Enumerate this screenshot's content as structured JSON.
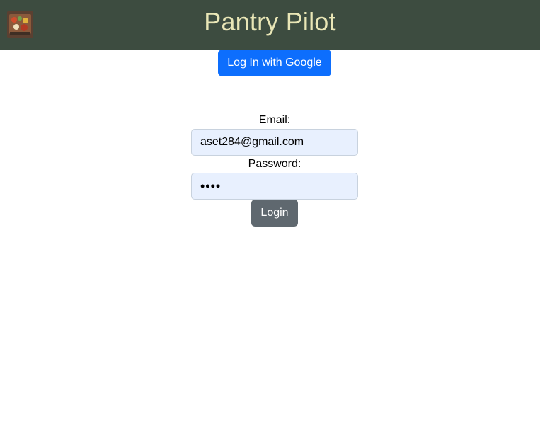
{
  "header": {
    "title": "Pantry Pilot",
    "logo_icon": "food-tray-icon",
    "background_color": "#3d4c40",
    "title_color": "#e9e6b6"
  },
  "auth": {
    "google_button_label": "Log In with Google",
    "google_button_color": "#0d6efd",
    "email_label": "Email:",
    "email_value": "aset284@gmail.com",
    "password_label": "Password:",
    "password_value": "••••",
    "login_button_label": "Login",
    "login_button_color": "#5f686f"
  }
}
